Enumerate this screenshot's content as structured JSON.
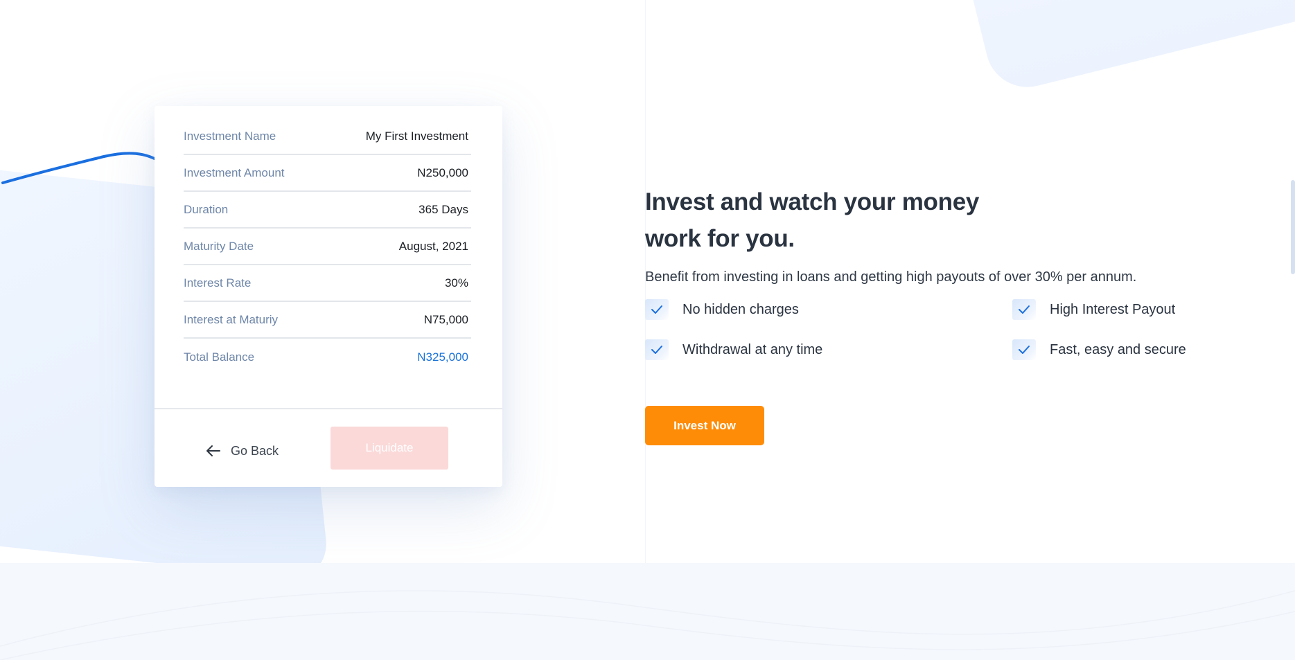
{
  "card": {
    "rows": [
      {
        "label": "Investment Name",
        "value": "My First Investment"
      },
      {
        "label": "Investment Amount",
        "value": "N250,000"
      },
      {
        "label": "Duration",
        "value": "365 Days"
      },
      {
        "label": "Maturity Date",
        "value": "August, 2021"
      },
      {
        "label": "Interest Rate",
        "value": "30%"
      },
      {
        "label": "Interest at Maturiy",
        "value": "N75,000"
      },
      {
        "label": "Total Balance",
        "value": "N325,000"
      }
    ],
    "go_back_label": "Go Back",
    "liquidate_label": "Liquidate"
  },
  "hero": {
    "headline_line1": "Invest and watch your money",
    "headline_line2": "work for you.",
    "subtitle": "Benefit from investing in loans and getting high payouts of over 30% per annum.",
    "features": [
      "No hidden charges",
      "High Interest Payout",
      "Withdrawal at any time",
      "Fast, easy and secure"
    ],
    "cta_label": "Invest Now"
  },
  "icons": {
    "back": "arrow-left-icon",
    "check": "check-icon"
  },
  "colors": {
    "accent_blue": "#1a73d9",
    "cta_orange": "#ff8c07",
    "liquidate_disabled": "#fbd9d9",
    "label_blue_gray": "#6e86a8"
  }
}
